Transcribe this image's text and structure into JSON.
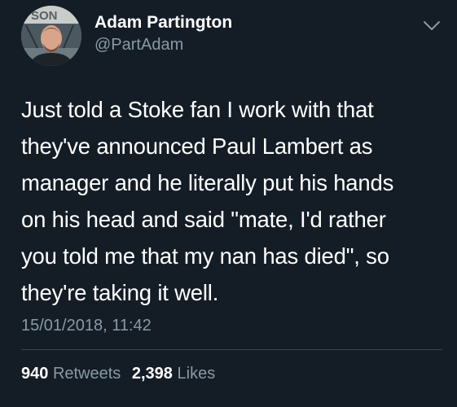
{
  "user": {
    "display_name": "Adam Partington",
    "handle": "@PartAdam",
    "avatar_banner_text": "SON"
  },
  "menu": {
    "icon": "chevron-down-icon"
  },
  "tweet": {
    "lines": [
      "Just told a Stoke fan I work with that",
      "they've announced Paul Lambert as",
      "manager and he literally put his hands",
      "on his head and said \"mate, I'd rather",
      "you told me that my nan has died\", so",
      "they're taking it well."
    ],
    "timestamp": "15/01/2018, 11:42"
  },
  "stats": {
    "retweets_count": "940",
    "retweets_label": "Retweets",
    "likes_count": "2,398",
    "likes_label": "Likes"
  },
  "colors": {
    "background": "#141d26",
    "primary_text": "#ffffff",
    "secondary_text": "#8899a6",
    "divider": "#38444d"
  }
}
